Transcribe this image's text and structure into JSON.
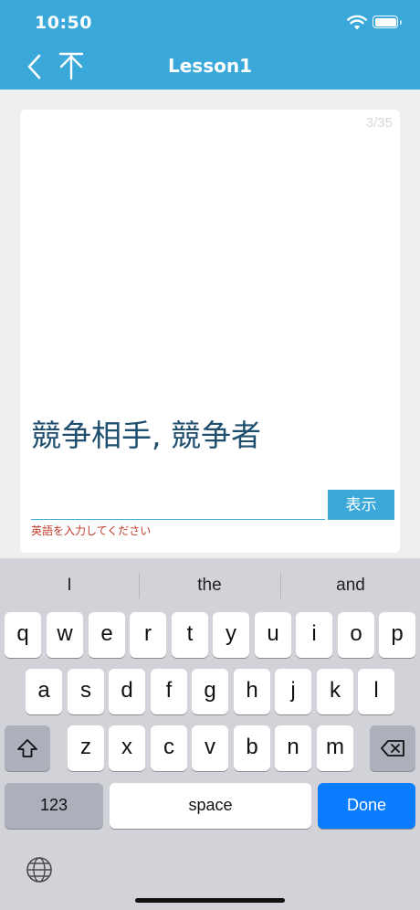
{
  "status": {
    "time": "10:50"
  },
  "nav": {
    "title": "Lesson1"
  },
  "card": {
    "counter": "3/35",
    "prompt": "競争相手, 競争者",
    "answer_value": "",
    "show_label": "表示",
    "hint": "英語を入力してください"
  },
  "keyboard": {
    "suggestions": [
      "I",
      "the",
      "and"
    ],
    "row1": [
      "q",
      "w",
      "e",
      "r",
      "t",
      "y",
      "u",
      "i",
      "o",
      "p"
    ],
    "row2": [
      "a",
      "s",
      "d",
      "f",
      "g",
      "h",
      "j",
      "k",
      "l"
    ],
    "row3": [
      "z",
      "x",
      "c",
      "v",
      "b",
      "n",
      "m"
    ],
    "numbers_label": "123",
    "space_label": "space",
    "done_label": "Done"
  },
  "colors": {
    "accent": "#3aa9d9",
    "prompt": "#1f4f6e",
    "hint": "#c0392b",
    "done": "#0a7cff"
  }
}
